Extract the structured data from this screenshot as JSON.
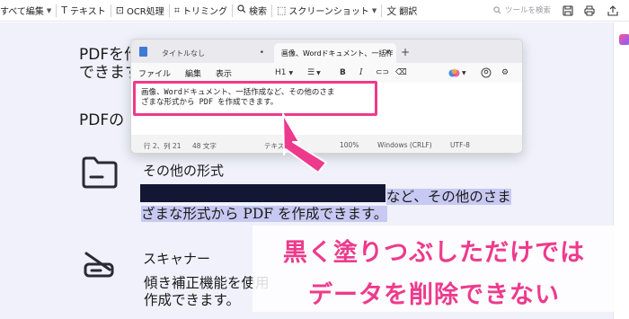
{
  "toolbar": {
    "items": [
      {
        "label": "すべて編集",
        "icon": "edit-icon"
      },
      {
        "label": "テキスト",
        "icon": "text-icon"
      },
      {
        "label": "OCR処理",
        "icon": "ocr-icon"
      },
      {
        "label": "トリミング",
        "icon": "crop-icon"
      },
      {
        "label": "検索",
        "icon": "search-icon"
      },
      {
        "label": "スクリーンショット",
        "icon": "screenshot-icon"
      },
      {
        "label": "翻訳",
        "icon": "translate-icon"
      }
    ],
    "search_placeholder": "ツールを検索"
  },
  "document": {
    "heading_1_line1": "PDFを作",
    "heading_1_line2": "できます",
    "heading_2": "PDFの",
    "section_other_title": "その他の形式",
    "section_other_line1": "など、その他のさま",
    "section_other_line2": "ざまな形式から PDF を作成できます。",
    "section_scanner_title": "スキャナー",
    "section_scanner_line1": "傾き補正機能を使用",
    "section_scanner_line2": "作成できます。"
  },
  "notepad": {
    "tab_inactive": "タイトルなし",
    "tab_active": "画像、Wordドキュメント、一括作",
    "menus": [
      "ファイル",
      "編集",
      "表示"
    ],
    "heading_level": "H1",
    "bold": "B",
    "italic": "I",
    "text_line1": "画像、Wordドキュメント、一括作成など、その他のさま",
    "text_line2": "ざまな形式から PDF を作成できます。",
    "status": {
      "position": "行 2、列 21",
      "chars": "48 文字",
      "mode": "テキスト",
      "zoom": "100%",
      "eol": "Windows (CRLF)",
      "encoding": "UTF-8"
    }
  },
  "callout": {
    "line1": "黒く塗りつぶしただけでは",
    "line2": "データを削除できない"
  },
  "colors": {
    "accent_pink": "#ee3a8c",
    "redaction": "#141733",
    "highlight": "#c7c9f2",
    "doc_background": "#f0f1fb"
  }
}
